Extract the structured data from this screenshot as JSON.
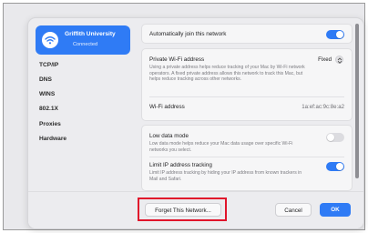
{
  "sidebar": {
    "network": {
      "name": "Griffith University",
      "status": "Connected",
      "icon": "wifi-icon"
    },
    "items": [
      "TCP/IP",
      "DNS",
      "WINS",
      "802.1X",
      "Proxies",
      "Hardware"
    ]
  },
  "settings": {
    "auto_join": {
      "label": "Automatically join this network",
      "enabled": true
    },
    "private_address": {
      "label": "Private Wi-Fi address",
      "value": "Fixed",
      "description": "Using a private address helps reduce tracking of your Mac by Wi-Fi network operators. A fixed private address allows this network to track this Mac, but helps reduce tracking across other networks."
    },
    "wifi_address": {
      "label": "Wi-Fi address",
      "value": "1a:ef:ac:9c:8e:a2"
    },
    "low_data": {
      "label": "Low data mode",
      "enabled": false,
      "description": "Low data mode helps reduce your Mac data usage over specific Wi-Fi networks you select."
    },
    "limit_ip": {
      "label": "Limit IP address tracking",
      "enabled": true,
      "description": "Limit IP address tracking by hiding your IP address from known trackers in Mail and Safari."
    }
  },
  "footer": {
    "forget_label": "Forget This Network...",
    "cancel_label": "Cancel",
    "ok_label": "OK"
  },
  "colors": {
    "accent": "#2f7bf5",
    "highlight": "#e0142b"
  }
}
